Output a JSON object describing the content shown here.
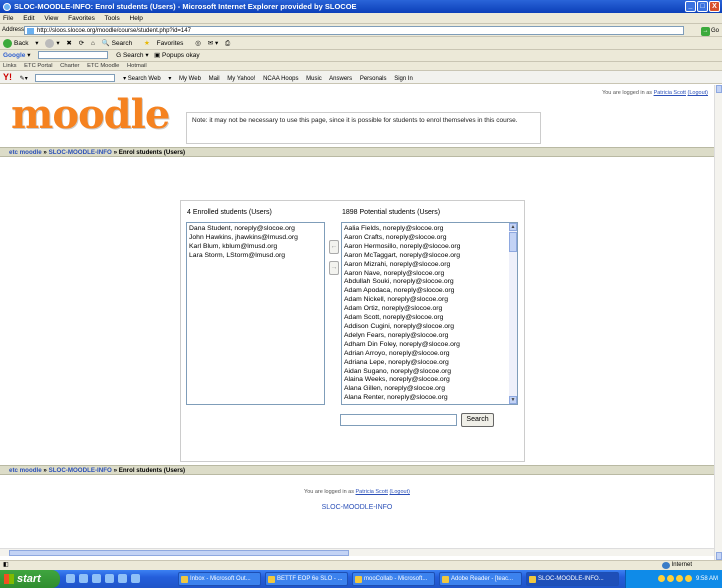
{
  "window": {
    "title": "SLOC-MOODLE-INFO: Enrol students (Users) - Microsoft Internet Explorer provided by SLOCOE",
    "controls": [
      "_",
      "□",
      "X"
    ]
  },
  "menu": [
    "File",
    "Edit",
    "View",
    "Favorites",
    "Tools",
    "Help"
  ],
  "address": {
    "label": "Address",
    "url": "http://sloos.slocoe.org/moodle/course/student.php?id=147",
    "go": "Go"
  },
  "std_toolbar": {
    "back": "Back",
    "search": "Search",
    "favorites": "Favorites"
  },
  "google_bar": {
    "brand": "Google",
    "search": "Search",
    "popups": "Popups okay"
  },
  "links_bar": {
    "label": "Links",
    "items": [
      "ETC Portal",
      "Charter",
      "ETC Moodle",
      "Hotmail"
    ]
  },
  "yahoo_bar": {
    "brand": "Y!",
    "search_web": "Search Web",
    "items": [
      "My Web",
      "Mail",
      "My Yahoo!",
      "NCAA Hoops",
      "Music",
      "Answers",
      "Personals",
      "Sign In"
    ]
  },
  "page": {
    "logo": "moodle",
    "login_prefix": "You are logged in as",
    "user_name": "Patricia Scott",
    "logout": "(Logout)",
    "breadcrumb": {
      "home": "etc moodle",
      "sep": "»",
      "course": "SLOC-MOODLE-INFO",
      "current": "Enrol students (Users)"
    },
    "note": "Note: it may not be necessary to use this page, since it is possible for students to enrol themselves in this course.",
    "enrolled_label": "4 Enrolled students (Users)",
    "enrolled": [
      "Dana Student, noreply@slocoe.org",
      "John Hawkins, jhawkins@lmusd.org",
      "Karl Blum, kblum@lmusd.org",
      "Lara Storm, LStorm@lmusd.org"
    ],
    "add_arrow": "←",
    "remove_arrow": "→",
    "potential_label": "1898 Potential students (Users)",
    "potential": [
      "Aalia Fields, noreply@slocoe.org",
      "Aaron Crafts, noreply@slocoe.org",
      "Aaron Hermosillo, noreply@slocoe.org",
      "Aaron McTaggart, noreply@slocoe.org",
      "Aaron Mizrahi, noreply@slocoe.org",
      "Aaron Nave, noreply@slocoe.org",
      "Abdullah Souki, noreply@slocoe.org",
      "Adam Apodaca, noreply@slocoe.org",
      "Adam Nickell, noreply@slocoe.org",
      "Adam Ortiz, noreply@slocoe.org",
      "Adam Scott, noreply@slocoe.org",
      "Addison Cugini, noreply@slocoe.org",
      "Adelyn Fears, noreply@slocoe.org",
      "Adham Din Foley, noreply@slocoe.org",
      "Adrian Arroyo, noreply@slocoe.org",
      "Adriana Lepe, noreply@slocoe.org",
      "Aidan Sugano, noreply@slocoe.org",
      "Alaina Weeks, noreply@slocoe.org",
      "Alana Gillen, noreply@slocoe.org",
      "Alana Renter, noreply@slocoe.org"
    ],
    "search_button": "Search",
    "footer_link": "SLOC-MOODLE-INFO"
  },
  "status": {
    "zone": "Internet"
  },
  "taskbar": {
    "start": "start",
    "tasks": [
      "Inbox - Microsoft Out...",
      "BETTF EOP 6e SLO - ...",
      "mooCollab - Microsoft...",
      "Adobe Reader - [teac...",
      "SLOC-MOODLE-INFO..."
    ],
    "clock": "9:58 AM"
  }
}
